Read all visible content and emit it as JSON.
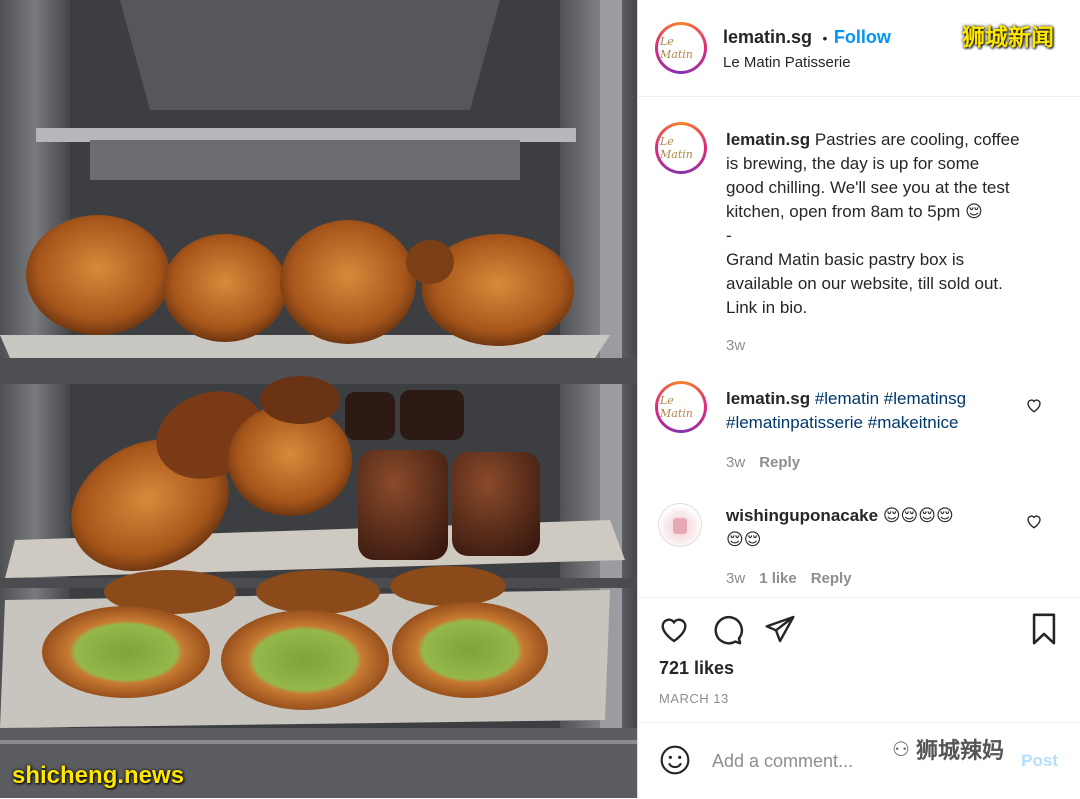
{
  "post": {
    "username": "lematin.sg",
    "separator": "•",
    "follow_label": "Follow",
    "subtitle": "Le Matin Patisserie",
    "avatar_text": "Le Matin",
    "caption_line1": "Pastries are cooling, coffee",
    "caption_line2": "is brewing, the day is up for some",
    "caption_line3": "good chilling. We'll see you at the test",
    "caption_line4": "kitchen, open from 8am to 5pm 😌",
    "caption_dash": "-",
    "caption_line5": "Grand Matin basic pastry box is",
    "caption_line6": "available on our website, till sold out.",
    "caption_line7": "Link in bio.",
    "caption_time": "3w"
  },
  "comments": [
    {
      "username": "lematin.sg",
      "tags_line1": "#lematin #lematinsg",
      "tags_line2": "#lematinpatisserie #makeitnice",
      "time": "3w",
      "reply_label": "Reply"
    },
    {
      "username": "wishinguponacake",
      "emoji_line1": "😌😌😌😌",
      "emoji_line2": "😌😌",
      "time": "3w",
      "likes_label": "1 like",
      "reply_label": "Reply"
    }
  ],
  "likes_text": "721 likes",
  "date_text": "MARCH 13",
  "comment_placeholder": "Add a comment...",
  "post_label": "Post",
  "watermarks": {
    "top_right": "狮城新闻",
    "bottom_left": "shicheng.news",
    "bottom_right": "狮城辣妈"
  },
  "colors": {
    "follow": "#0095f6",
    "hashtag": "#00376b",
    "muted": "#8e8e8e"
  }
}
